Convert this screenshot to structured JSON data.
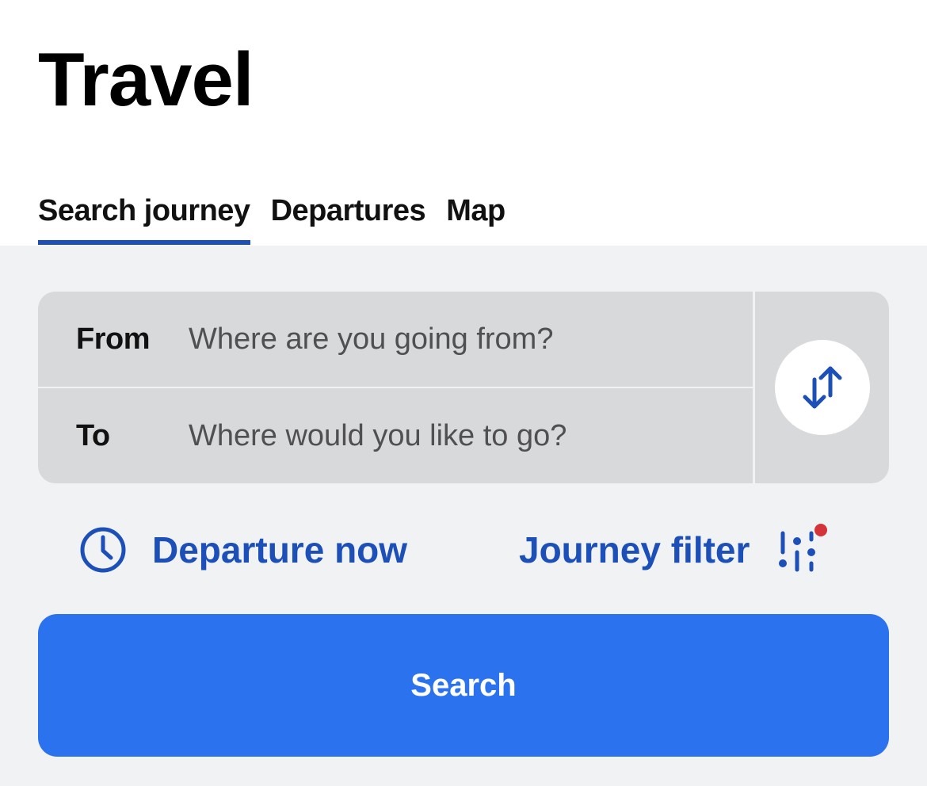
{
  "page": {
    "title": "Travel"
  },
  "tabs": [
    {
      "label": "Search journey",
      "active": true
    },
    {
      "label": "Departures",
      "active": false
    },
    {
      "label": "Map",
      "active": false
    }
  ],
  "route": {
    "from_label": "From",
    "from_placeholder": "Where are you going from?",
    "from_value": "",
    "to_label": "To",
    "to_placeholder": "Where would you like to go?",
    "to_value": "",
    "swap_icon": "swap-vertical-arrows-icon"
  },
  "options": {
    "departure_label": "Departure now",
    "departure_icon": "clock-icon",
    "filter_label": "Journey filter",
    "filter_icon": "sliders-filter-icon",
    "filter_indicator": true
  },
  "search_button": {
    "label": "Search"
  },
  "colors": {
    "accent": "#1c4fb8",
    "primary_button": "#2a72ee",
    "panel_background": "#f0f2f4",
    "input_background": "#d8d9db",
    "indicator_dot": "#d4333a"
  }
}
